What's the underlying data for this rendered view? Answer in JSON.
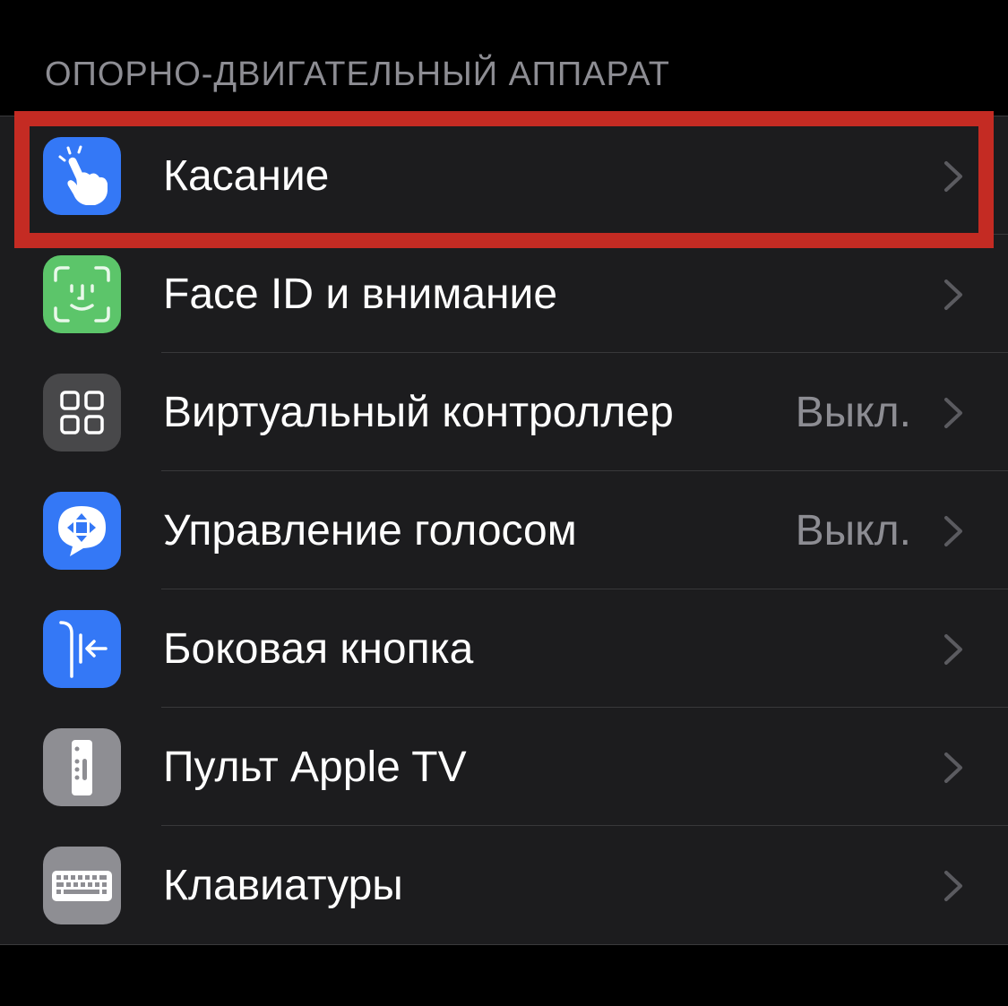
{
  "section": {
    "title": "ОПОРНО-ДВИГАТЕЛЬНЫЙ АППАРАТ"
  },
  "colors": {
    "background": "#000000",
    "list_background": "#1c1c1e",
    "section_header": "#8d8d93",
    "value_text": "#8d8d93",
    "chevron": "#5b5b60",
    "highlight_frame": "#c42b23"
  },
  "items": [
    {
      "label": "Касание",
      "value": "",
      "icon": "hand-pointer-icon",
      "icon_bg": "#3478f6"
    },
    {
      "label": "Face ID и внимание",
      "value": "",
      "icon": "face-id-icon",
      "icon_bg": "#5cc56a"
    },
    {
      "label": "Виртуальный контроллер",
      "value": "Выкл.",
      "icon": "grid-squares-icon",
      "icon_bg": "#48484a"
    },
    {
      "label": "Управление голосом",
      "value": "Выкл.",
      "icon": "voice-control-bubble-icon",
      "icon_bg": "#3478f6"
    },
    {
      "label": "Боковая кнопка",
      "value": "",
      "icon": "side-button-arrow-icon",
      "icon_bg": "#3478f6"
    },
    {
      "label": "Пульт Apple TV",
      "value": "",
      "icon": "tv-remote-icon",
      "icon_bg": "#8e8e93"
    },
    {
      "label": "Клавиатуры",
      "value": "",
      "icon": "keyboard-icon",
      "icon_bg": "#8e8e93"
    }
  ]
}
